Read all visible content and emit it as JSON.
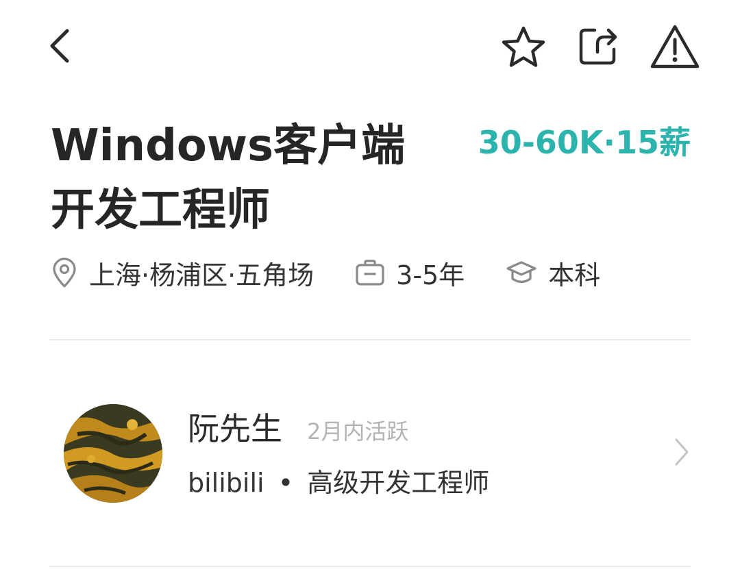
{
  "header": {
    "back_icon": "chevron-left-icon",
    "favorite_icon": "star-icon",
    "share_icon": "share-icon",
    "report_icon": "warning-triangle-icon"
  },
  "job": {
    "title_line1": "Windows客户端",
    "title_line2": "开发工程师",
    "salary": "30-60K·15薪",
    "salary_color": "#2db3ad",
    "location": "上海·杨浦区·五角场",
    "experience": "3-5年",
    "education": "本科"
  },
  "recruiter": {
    "name": "阮先生",
    "active_status": "2月内活跃",
    "company": "bilibili",
    "separator": "•",
    "position": "高级开发工程师"
  }
}
